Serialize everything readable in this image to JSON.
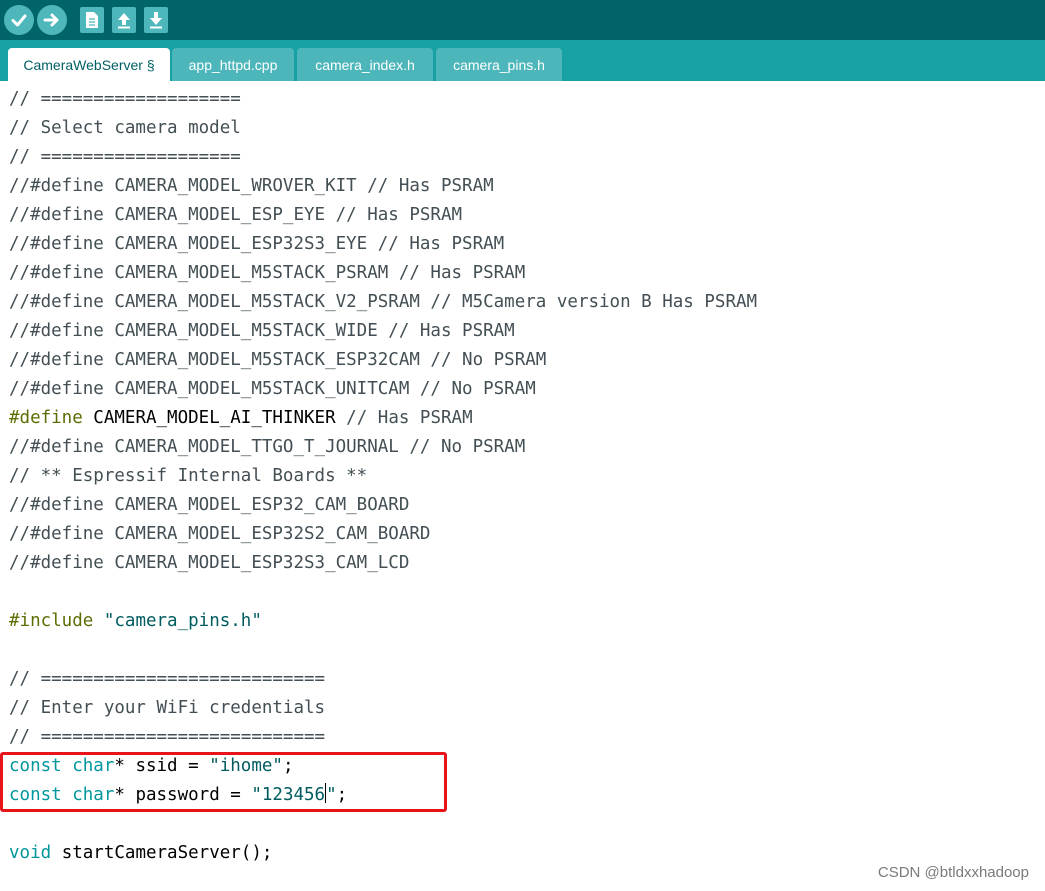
{
  "toolbar": {
    "buttons": [
      {
        "name": "verify",
        "icon": "check-icon"
      },
      {
        "name": "upload",
        "icon": "arrow-right-icon"
      },
      {
        "name": "new",
        "icon": "new-file-icon"
      },
      {
        "name": "open",
        "icon": "arrow-up-icon"
      },
      {
        "name": "save",
        "icon": "arrow-down-icon"
      }
    ]
  },
  "tabs": [
    {
      "label": "CameraWebServer §",
      "active": true
    },
    {
      "label": "app_httpd.cpp",
      "active": false
    },
    {
      "label": "camera_index.h",
      "active": false
    },
    {
      "label": "camera_pins.h",
      "active": false
    }
  ],
  "editor": {
    "lines": {
      "l1": "// ===================",
      "l2": "// Select camera model",
      "l3": "// ===================",
      "l4": "//#define CAMERA_MODEL_WROVER_KIT // Has PSRAM",
      "l5": "//#define CAMERA_MODEL_ESP_EYE // Has PSRAM",
      "l6": "//#define CAMERA_MODEL_ESP32S3_EYE // Has PSRAM",
      "l7": "//#define CAMERA_MODEL_M5STACK_PSRAM // Has PSRAM",
      "l8": "//#define CAMERA_MODEL_M5STACK_V2_PSRAM // M5Camera version B Has PSRAM",
      "l9": "//#define CAMERA_MODEL_M5STACK_WIDE // Has PSRAM",
      "l10": "//#define CAMERA_MODEL_M5STACK_ESP32CAM // No PSRAM",
      "l11": "//#define CAMERA_MODEL_M5STACK_UNITCAM // No PSRAM",
      "l12_kw": "#define",
      "l12_name": " CAMERA_MODEL_AI_THINKER",
      "l12_comment": " // Has PSRAM",
      "l13": "//#define CAMERA_MODEL_TTGO_T_JOURNAL // No PSRAM",
      "l14": "// ** Espressif Internal Boards **",
      "l15": "//#define CAMERA_MODEL_ESP32_CAM_BOARD",
      "l16": "//#define CAMERA_MODEL_ESP32S2_CAM_BOARD",
      "l17": "//#define CAMERA_MODEL_ESP32S3_CAM_LCD",
      "l19_kw": "#include",
      "l19_str": " \"camera_pins.h\"",
      "l21": "// ===========================",
      "l22": "// Enter your WiFi credentials",
      "l23": "// ===========================",
      "l24_kw1": "const",
      "l24_kw2": " char",
      "l24_rest": "* ssid = ",
      "l24_str": "\"ihome\"",
      "l24_end": ";",
      "l25_kw1": "const",
      "l25_kw2": " char",
      "l25_rest": "* password = ",
      "l25_str_a": "\"123456",
      "l25_str_b": "\"",
      "l25_end": ";",
      "l27_kw": "void",
      "l27_rest": " startCameraServer();"
    }
  },
  "watermark": "CSDN @btldxxhadoop"
}
